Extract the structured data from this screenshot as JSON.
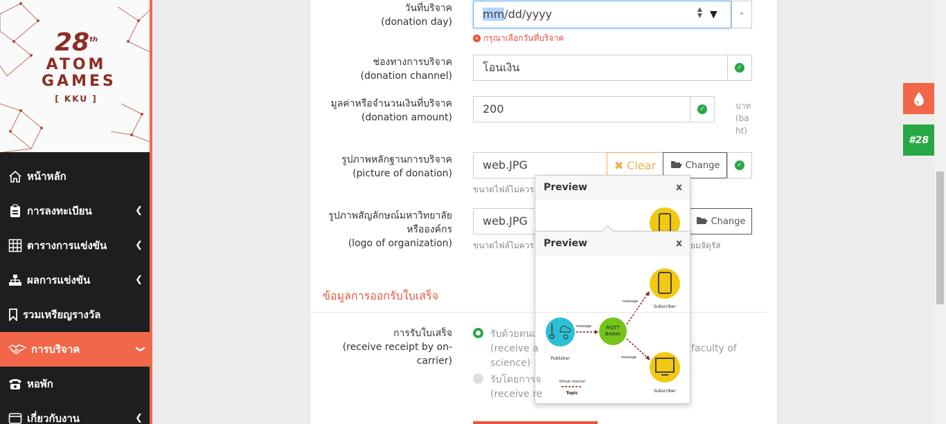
{
  "logo": {
    "number": "28",
    "suffix": "th",
    "line1": "ATOM",
    "line2": "GAMES",
    "badge": "[ KKU ]"
  },
  "sidebar": {
    "items": [
      {
        "label": "หน้าหลัก",
        "icon": "home-icon",
        "has_chevron": false,
        "active": false
      },
      {
        "label": "การลงทะเบียน",
        "icon": "register-icon",
        "has_chevron": true,
        "active": false
      },
      {
        "label": "ตารางการแข่งขัน",
        "icon": "table-icon",
        "has_chevron": true,
        "active": false
      },
      {
        "label": "ผลการแข่งขัน",
        "icon": "sitemap-icon",
        "has_chevron": true,
        "active": false
      },
      {
        "label": "รวมเหรียญรางวัล",
        "icon": "bookmark-icon",
        "has_chevron": false,
        "active": false
      },
      {
        "label": "การบริจาค",
        "icon": "handshake-icon",
        "has_chevron": true,
        "active": true
      },
      {
        "label": "หอพัก",
        "icon": "phone-icon",
        "has_chevron": false,
        "active": false
      },
      {
        "label": "เกี่ยวกับงาน",
        "icon": "window-icon",
        "has_chevron": true,
        "active": false
      }
    ]
  },
  "form": {
    "donation_day": {
      "label_th": "วันที่บริจาค",
      "label_en": "(donation day)",
      "placeholder_selected": "mm",
      "placeholder_rest": "/dd/yyyy",
      "required_mark": "*",
      "error": "กรุณาเลือกวันที่บริจาค"
    },
    "donation_channel": {
      "label_th": "ช่องทางการบริจาค",
      "label_en": "(donation channel)",
      "value": "โอนเงิน"
    },
    "donation_amount": {
      "label_th": "มูลค่าหรือจำนวนเงินที่บริจาค",
      "label_en": "(donation amount)",
      "value": "200",
      "unit_lines": [
        "บาท",
        "(ba",
        "ht)"
      ]
    },
    "picture_of_donation": {
      "label_th": "รูปภาพหลักฐานการบริจาค",
      "label_en": "(picture of donation)",
      "filename": "web.JPG",
      "clear_label": "Clear",
      "change_label": "Change",
      "hint": "ขนาดไฟล์ไม่ควรเ"
    },
    "logo_of_organization": {
      "label_th_1": "รูปภาพสัญลักษณ์มหาวิทยาลัย",
      "label_th_2": "หรือองค์กร",
      "label_en": "(logo of organization)",
      "filename": "web.JPG",
      "change_label": "Change",
      "hint_left": "ขนาดไฟล์ไม่ควรเ",
      "hint_right": "ยมจัตุรัส"
    },
    "receipt_section_title": "ข้อมูลการออกรับใบเสร็จ",
    "receive_receipt": {
      "label_th": "การรับใบเสร็จ",
      "label_en_1": "(receive receipt by on-",
      "label_en_2": "carrier)",
      "option1_line1": "รับด้วยตนเ",
      "option1_line2": "(receive a",
      "option1_line2_right": "faculty of",
      "option1_line3": "science)",
      "option2_line1": "รับโดยการจ",
      "option2_line2": "(receive re"
    }
  },
  "popovers": [
    {
      "title": "Preview",
      "close": "x"
    },
    {
      "title": "Preview",
      "close": "x"
    }
  ],
  "diagram": {
    "publisher": "Publisher",
    "broker_1": "MQTT",
    "broker_2": "Broker",
    "message_a": "message",
    "message_b": "message",
    "message_c": "message",
    "subscriber_top": "Subscriber",
    "subscriber_bottom": "Subscriber",
    "virtual_channel": "Virtual channel",
    "topic": "Topic"
  },
  "side_buttons": {
    "blood_icon": "drop-icon",
    "badge_label": "#28"
  },
  "colors": {
    "accent": "#f26649",
    "success": "#28a745",
    "error": "#e74c3c",
    "sidebar_bg": "#1e1e1e",
    "warning": "#f0ad4e"
  }
}
